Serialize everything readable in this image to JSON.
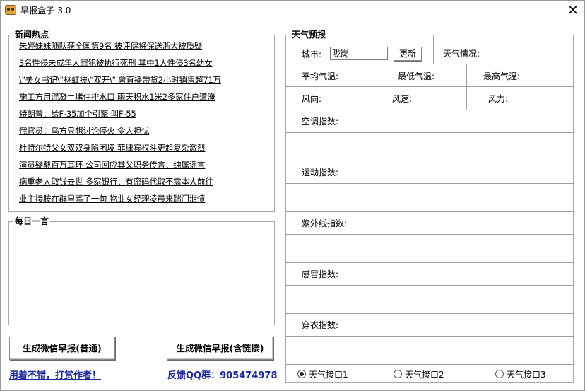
{
  "window": {
    "title": "早报盒子-3.0",
    "close_glyph": "✕"
  },
  "news": {
    "group_title": "新闻热点",
    "items": [
      "朱婷妹妹随队获全国第9名 被评健将保送浙大被质疑",
      "3名性侵未成年人罪犯被执行死刑 其中1人性侵3名幼女",
      "\\\"美女书记\\\"林虹被\\\"双开\\\" 曾直播带货2小时销售超71万",
      "施工方用混凝土堵住排水口 雨天积水1米2多家住户遭淹",
      "特朗普：给F-35加个引擎 叫F-55",
      "俄官员：乌方只想讨论停火 令人担忧",
      "杜特尔特父女双双身陷困境 菲律宾权斗更趋复杂激烈",
      "演员疑戴百万耳环 公司回应其父职务传言：纯属谣言",
      "病重老人取钱去世 多家银行：有密码代取不需本人前往",
      "业主接胺在群里骂了一句 物业女经理凌晨来踹门泄愤"
    ]
  },
  "daily": {
    "group_title": "每日一言"
  },
  "buttons": {
    "normal": "生成微信早报(普通)",
    "with_links": "生成微信早报(含链接)"
  },
  "footer": {
    "donate": "用着不错，打赏作者！",
    "feedback": "反馈QQ群：905474978"
  },
  "weather": {
    "group_title": "天气预报",
    "city_label": "城市:",
    "city_value": "陇岗",
    "refresh_label": "更新",
    "condition_label": "天气情况:",
    "avg_temp_label": "平均气温:",
    "min_temp_label": "最低气温:",
    "max_temp_label": "最高气温:",
    "wind_dir_label": "风向:",
    "wind_speed_label": "风速:",
    "wind_power_label": "风力:",
    "indices": [
      "空调指数:",
      "运动指数:",
      "紫外线指数:",
      "感冒指数:",
      "穿衣指数:"
    ],
    "api_options": [
      {
        "label": "天气接口1",
        "selected": true
      },
      {
        "label": "天气接口2",
        "selected": false
      },
      {
        "label": "天气接口3",
        "selected": false
      }
    ]
  },
  "colors": {
    "footer_text": "#1c2aa0",
    "border": "#a0a0a0"
  }
}
